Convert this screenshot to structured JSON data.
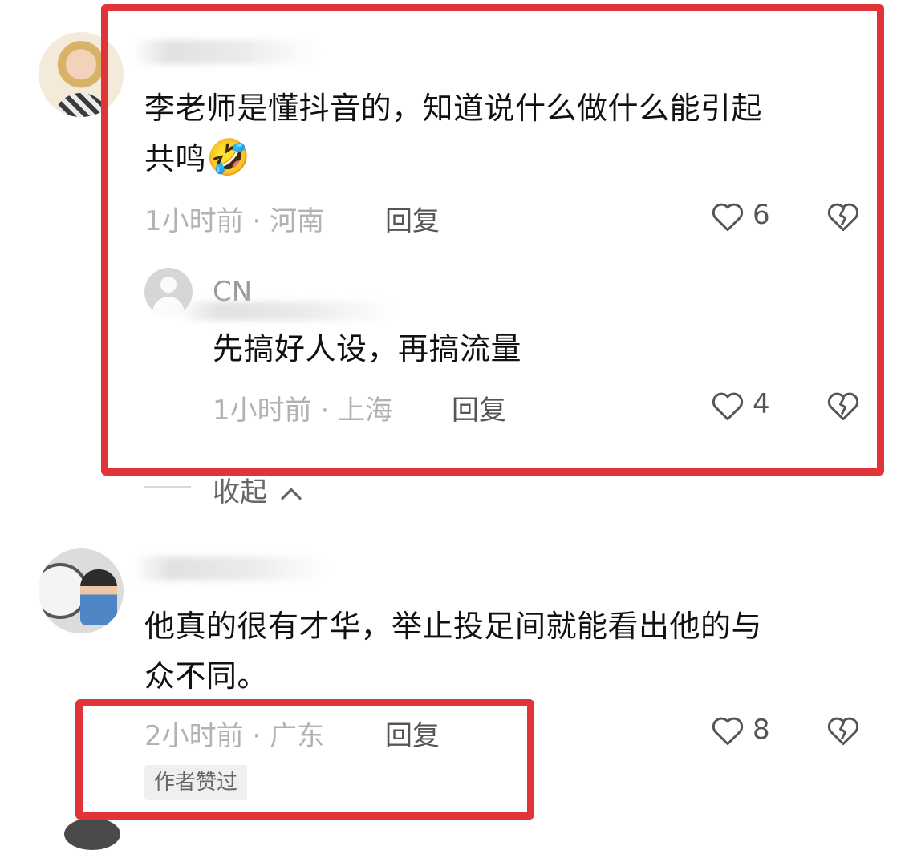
{
  "accent_color": "#e0333a",
  "comments": [
    {
      "text_line1": "李老师是懂抖音的，知道说什么做什么能引起",
      "text_line2": "共鸣",
      "emoji": "🤣",
      "time": "1小时前",
      "location": "河南",
      "reply_label": "回复",
      "likes": "6",
      "replies": [
        {
          "username": "CN",
          "text": "先搞好人设，再搞流量",
          "time": "1小时前",
          "location": "上海",
          "reply_label": "回复",
          "likes": "4"
        }
      ],
      "collapse_label": "收起"
    },
    {
      "text_line1": "他真的很有才华，举止投足间就能看出他的与",
      "text_line2": "众不同。",
      "time": "2小时前",
      "location": "广东",
      "reply_label": "回复",
      "likes": "8",
      "badge": "作者赞过"
    }
  ],
  "separator": "·"
}
